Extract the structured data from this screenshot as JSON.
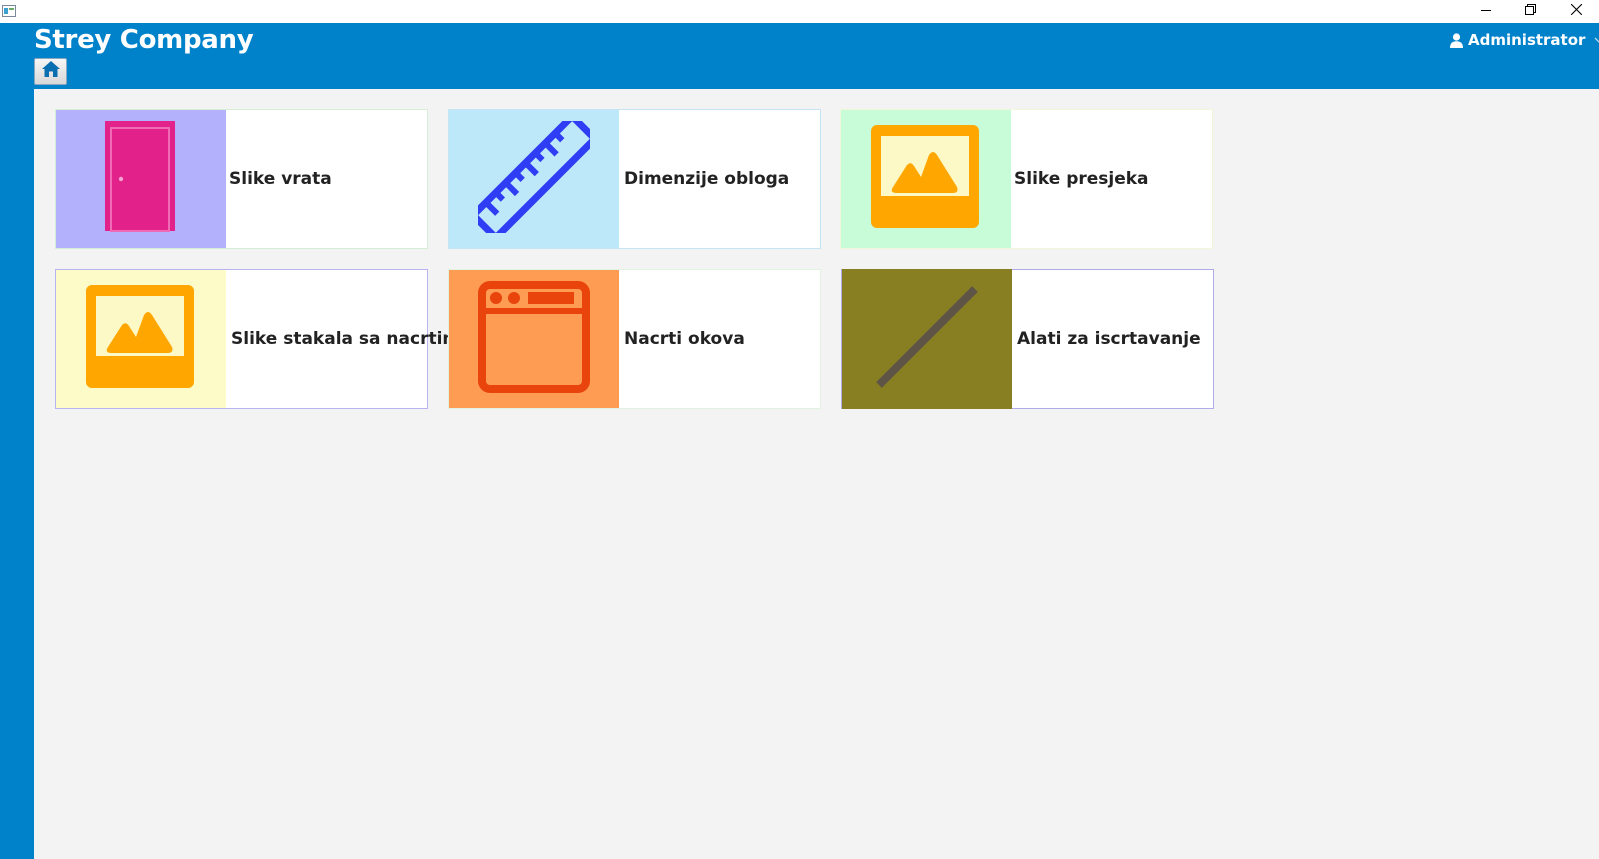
{
  "app": {
    "brand": "Strey Company",
    "user": "Administrator"
  },
  "window": {
    "controls": [
      "minimize-icon",
      "restore-icon",
      "close-icon"
    ]
  },
  "toolbar": {
    "home_icon": "home-icon"
  },
  "tiles": [
    {
      "label": "Slike vrata",
      "icon": "door-icon",
      "bg": "#b3b0fc"
    },
    {
      "label": "Dimenzije obloga",
      "icon": "ruler-icon",
      "bg": "#bce8fa"
    },
    {
      "label": "Slike presjeka",
      "icon": "image-icon",
      "bg": "#c8fcd8"
    },
    {
      "label": "Slike stakala sa nacrtim",
      "icon": "image-icon",
      "bg": "#fdfcc8"
    },
    {
      "label": "Nacrti okova",
      "icon": "browser-window-icon",
      "bg": "#fe9c54"
    },
    {
      "label": "Alati za iscrtavanje",
      "icon": "line-tool-icon",
      "bg": "#887f23"
    }
  ],
  "colors": {
    "accent": "#0082cb",
    "background": "#f3f3f3"
  }
}
